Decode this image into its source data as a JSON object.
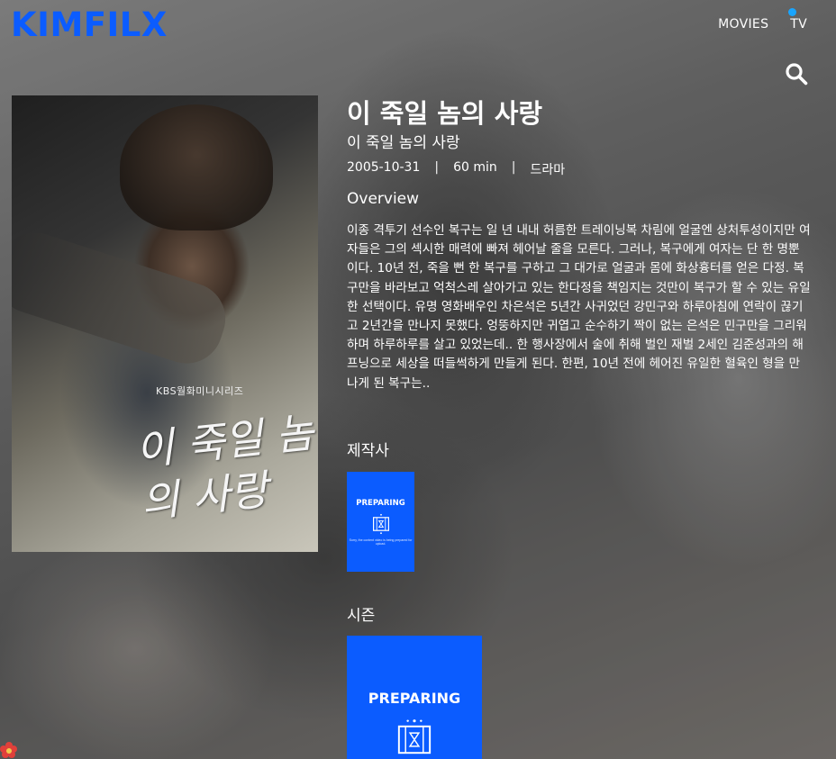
{
  "header": {
    "logo": "KIMFILX",
    "nav": [
      {
        "label": "MOVIES"
      },
      {
        "label": "TV"
      }
    ],
    "accent_color": "#0b5cff",
    "active_dot_color": "#19a5ff",
    "search_icon": "search-icon"
  },
  "poster": {
    "series_label": "KBS월화미니시리즈",
    "title_art": "이 죽일 놈의 사랑"
  },
  "details": {
    "title": "이 죽일 놈의 사랑",
    "original_title": "이 죽일 놈의 사랑",
    "date": "2005-10-31",
    "runtime": "60 min",
    "genre": "드라마",
    "separator": "|",
    "overview_heading": "Overview",
    "overview": "이종 격투기 선수인 복구는 일 년 내내 허름한 트레이닝복 차림에 얼굴엔 상처투성이지만 여자들은 그의 섹시한 매력에 빠져 헤어날 줄을 모른다. 그러나, 복구에게 여자는 단 한 명뿐이다. 10년 전, 죽을 뻔 한 복구를 구하고 그 대가로 얼굴과 몸에 화상흉터를 얻은 다정. 복구만을 바라보고 억척스레 살아가고 있는 한다정을 책임지는 것만이 복구가 할 수 있는 유일한 선택이다. 유명 영화배우인 차은석은 5년간 사귀었던 강민구와 하루아침에 연락이 끊기고 2년간을 만나지 못했다. 엉뚱하지만 귀엽고 순수하기 짝이 없는 은석은 민구만을 그리워하며 하루하루를 살고 있었는데.. 한 행사장에서 술에 취해 벌인 재벌 2세인 김준성과의 해프닝으로 세상을 떠들썩하게 만들게 된다. 한편, 10년 전에 헤어진 유일한 혈육인 형을 만나게 된 복구는..",
    "producer_heading": "제작사",
    "season_heading": "시즌",
    "placeholder": {
      "label": "PREPARING",
      "small": "Sorry, the content video is being prepared for upload.",
      "icon": "film-hourglass-icon"
    }
  }
}
